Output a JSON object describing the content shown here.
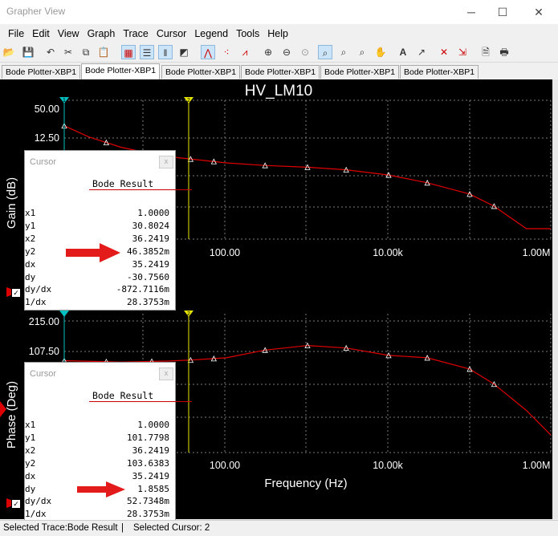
{
  "window": {
    "title": "Grapher View",
    "minimize": "─",
    "maximize": "☐",
    "close": "✕"
  },
  "menu": [
    "File",
    "Edit",
    "View",
    "Graph",
    "Trace",
    "Cursor",
    "Legend",
    "Tools",
    "Help"
  ],
  "toolbar_icons": [
    "open-icon",
    "save-icon",
    "undo-icon",
    "cut-icon",
    "copy-icon",
    "paste-icon",
    "grid-icon",
    "legend-icon",
    "cursors-icon",
    "reverse-colors-icon",
    "line-trace-icon",
    "dots-trace-icon",
    "line-dots-trace-icon",
    "zoom-in-icon",
    "zoom-out-icon",
    "zoom-area-icon",
    "zoom-full-icon",
    "zoom-x-icon",
    "zoom-y-icon",
    "pan-icon",
    "text-icon",
    "label-icon",
    "scatter-icon",
    "export-icon",
    "print-preview-icon",
    "print-icon"
  ],
  "tabs": [
    "Bode Plotter-XBP1",
    "Bode Plotter-XBP1",
    "Bode Plotter-XBP1",
    "Bode Plotter-XBP1",
    "Bode Plotter-XBP1",
    "Bode Plotter-XBP1"
  ],
  "active_tab": 1,
  "plot": {
    "title": "HV_LM10",
    "xlabel": "Frequency (Hz)",
    "gain_ylabel": "Gain (dB)",
    "phase_ylabel": "Phase (Deg)",
    "gain_ticks": [
      "50.00",
      "12.50"
    ],
    "phase_ticks": [
      "215.00",
      "107.50"
    ],
    "x_ticks_gain": [
      "100.00",
      "10.00k",
      "1.00M"
    ],
    "x_ticks_phase": [
      "100.00",
      "10.00k",
      "1.00M"
    ],
    "cursor1_marker": "1",
    "cursor2_marker": "2",
    "colors": {
      "trace": "#e00000",
      "cursor1": "#00c0c0",
      "cursor2": "#e8e800",
      "grid": "#777777",
      "background": "#000000"
    }
  },
  "chart_data": [
    {
      "type": "line",
      "title": "HV_LM10",
      "ylabel": "Gain (dB)",
      "xlabel": "Frequency (Hz)",
      "xscale": "log",
      "xlim": [
        1,
        1000000
      ],
      "series": [
        {
          "name": "Bode Result",
          "x": [
            1,
            2,
            5,
            10,
            20,
            100,
            300,
            1000,
            3000,
            10000,
            30000,
            100000,
            200000,
            500000,
            1000000
          ],
          "y": [
            30.8,
            18,
            6,
            0.05,
            -5,
            -12,
            -15,
            -17,
            -20,
            -26,
            -35,
            -48,
            -62,
            -88,
            -88
          ]
        }
      ]
    },
    {
      "type": "line",
      "ylabel": "Phase (Deg)",
      "xlabel": "Frequency (Hz)",
      "xscale": "log",
      "xlim": [
        1,
        1000000
      ],
      "series": [
        {
          "name": "Bode Result",
          "x": [
            1,
            5,
            20,
            36.2,
            100,
            300,
            1000,
            3000,
            10000,
            30000,
            100000,
            200000,
            500000,
            1000000
          ],
          "y": [
            101.8,
            98,
            101,
            103.6,
            110,
            132,
            145,
            138,
            117,
            110,
            78,
            35,
            -40,
            -110
          ]
        }
      ]
    }
  ],
  "cursor_gain": {
    "header": "Cursor",
    "close": "x",
    "title": "Bode Result",
    "rows": [
      [
        "x1",
        "1.0000"
      ],
      [
        "y1",
        "30.8024"
      ],
      [
        "x2",
        "36.2419"
      ],
      [
        "y2",
        "46.3852m"
      ],
      [
        "dx",
        "35.2419"
      ],
      [
        "dy",
        "-30.7560"
      ],
      [
        "dy/dx",
        "-872.7116m"
      ],
      [
        "1/dx",
        "28.3753m"
      ]
    ]
  },
  "cursor_phase": {
    "header": "Cursor",
    "close": "x",
    "title": "Bode Result",
    "rows": [
      [
        "x1",
        "1.0000"
      ],
      [
        "y1",
        "101.7798"
      ],
      [
        "x2",
        "36.2419"
      ],
      [
        "y2",
        "103.6383"
      ],
      [
        "dx",
        "35.2419"
      ],
      [
        "dy",
        "1.8585"
      ],
      [
        "dy/dx",
        "52.7348m"
      ],
      [
        "1/dx",
        "28.3753m"
      ]
    ]
  },
  "status": {
    "selected_trace": "Selected Trace:Bode Result",
    "separator": "|",
    "selected_cursor": "Selected Cursor: 2"
  }
}
